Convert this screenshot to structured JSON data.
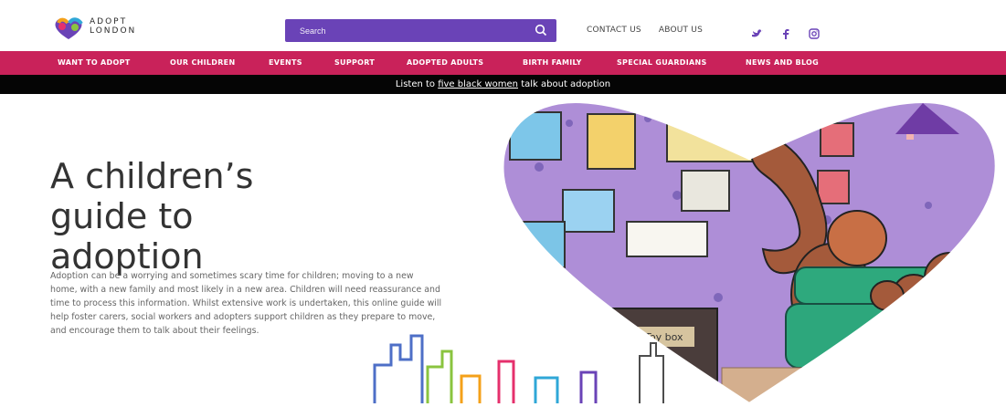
{
  "header": {
    "brand": [
      "ADOPT",
      "LONDON"
    ],
    "search_placeholder": "Search",
    "links": [
      "CONTACT US",
      "ABOUT US"
    ],
    "social": [
      "twitter-icon",
      "facebook-icon",
      "instagram-icon"
    ],
    "colors": {
      "purple": "#6a43b7",
      "pink": "#c9225a",
      "black": "#050505"
    }
  },
  "nav": {
    "items": [
      "WANT TO ADOPT",
      "OUR CHILDREN",
      "EVENTS",
      "SUPPORT",
      "ADOPTED ADULTS",
      "BIRTH FAMILY",
      "SPECIAL GUARDIANS",
      "NEWS AND BLOG"
    ]
  },
  "announcement": {
    "prefix": "Listen to ",
    "link": "five black women",
    "suffix": " talk about adoption"
  },
  "hero": {
    "title_lines": [
      "A children’s",
      "guide to",
      "adoption"
    ],
    "body": "Adoption can be a worrying and sometimes scary time for children; moving to a new home, with a new family and most likely in a new area. Children will need reassurance and time to process this information. Whilst extensive work is undertaken, this online guide will help foster carers, social workers and adopters support children as they prepare to move, and encourage them to talk about their feelings.",
    "toy_box_label": "Toy box"
  }
}
